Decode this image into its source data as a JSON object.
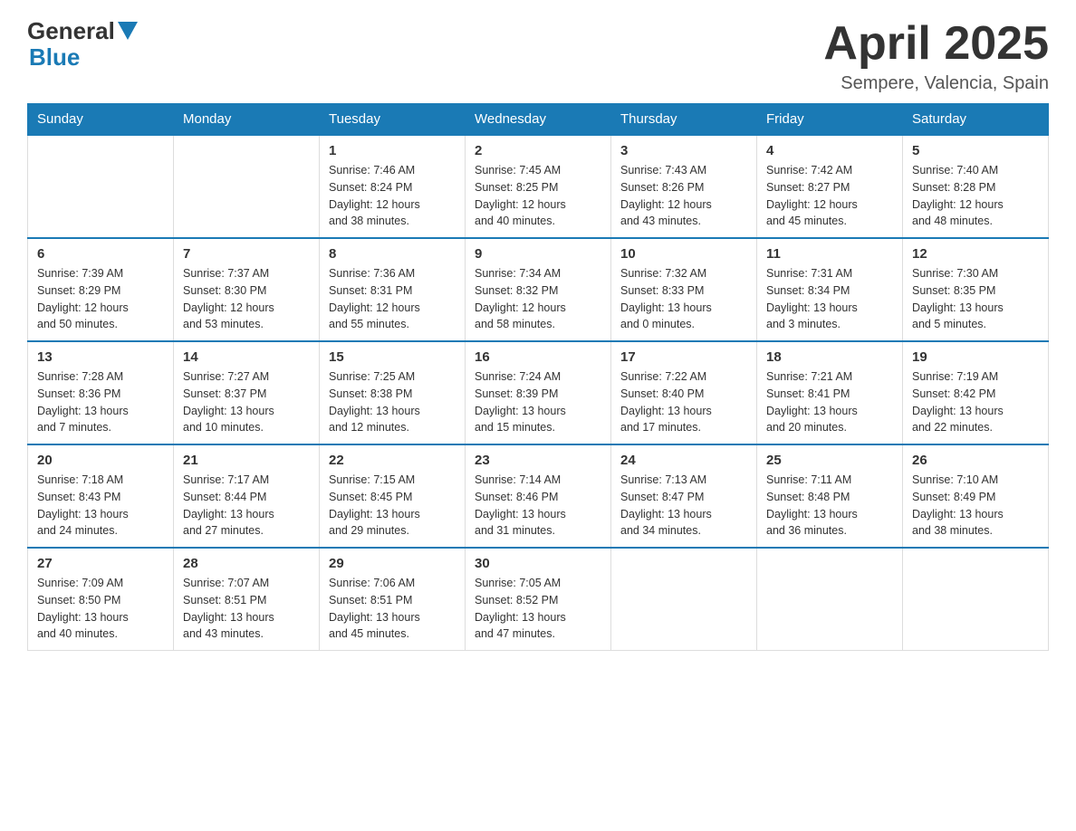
{
  "header": {
    "logo_general": "General",
    "logo_blue": "Blue",
    "month_title": "April 2025",
    "location": "Sempere, Valencia, Spain"
  },
  "days_of_week": [
    "Sunday",
    "Monday",
    "Tuesday",
    "Wednesday",
    "Thursday",
    "Friday",
    "Saturday"
  ],
  "weeks": [
    [
      {
        "day": "",
        "info": ""
      },
      {
        "day": "",
        "info": ""
      },
      {
        "day": "1",
        "info": "Sunrise: 7:46 AM\nSunset: 8:24 PM\nDaylight: 12 hours\nand 38 minutes."
      },
      {
        "day": "2",
        "info": "Sunrise: 7:45 AM\nSunset: 8:25 PM\nDaylight: 12 hours\nand 40 minutes."
      },
      {
        "day": "3",
        "info": "Sunrise: 7:43 AM\nSunset: 8:26 PM\nDaylight: 12 hours\nand 43 minutes."
      },
      {
        "day": "4",
        "info": "Sunrise: 7:42 AM\nSunset: 8:27 PM\nDaylight: 12 hours\nand 45 minutes."
      },
      {
        "day": "5",
        "info": "Sunrise: 7:40 AM\nSunset: 8:28 PM\nDaylight: 12 hours\nand 48 minutes."
      }
    ],
    [
      {
        "day": "6",
        "info": "Sunrise: 7:39 AM\nSunset: 8:29 PM\nDaylight: 12 hours\nand 50 minutes."
      },
      {
        "day": "7",
        "info": "Sunrise: 7:37 AM\nSunset: 8:30 PM\nDaylight: 12 hours\nand 53 minutes."
      },
      {
        "day": "8",
        "info": "Sunrise: 7:36 AM\nSunset: 8:31 PM\nDaylight: 12 hours\nand 55 minutes."
      },
      {
        "day": "9",
        "info": "Sunrise: 7:34 AM\nSunset: 8:32 PM\nDaylight: 12 hours\nand 58 minutes."
      },
      {
        "day": "10",
        "info": "Sunrise: 7:32 AM\nSunset: 8:33 PM\nDaylight: 13 hours\nand 0 minutes."
      },
      {
        "day": "11",
        "info": "Sunrise: 7:31 AM\nSunset: 8:34 PM\nDaylight: 13 hours\nand 3 minutes."
      },
      {
        "day": "12",
        "info": "Sunrise: 7:30 AM\nSunset: 8:35 PM\nDaylight: 13 hours\nand 5 minutes."
      }
    ],
    [
      {
        "day": "13",
        "info": "Sunrise: 7:28 AM\nSunset: 8:36 PM\nDaylight: 13 hours\nand 7 minutes."
      },
      {
        "day": "14",
        "info": "Sunrise: 7:27 AM\nSunset: 8:37 PM\nDaylight: 13 hours\nand 10 minutes."
      },
      {
        "day": "15",
        "info": "Sunrise: 7:25 AM\nSunset: 8:38 PM\nDaylight: 13 hours\nand 12 minutes."
      },
      {
        "day": "16",
        "info": "Sunrise: 7:24 AM\nSunset: 8:39 PM\nDaylight: 13 hours\nand 15 minutes."
      },
      {
        "day": "17",
        "info": "Sunrise: 7:22 AM\nSunset: 8:40 PM\nDaylight: 13 hours\nand 17 minutes."
      },
      {
        "day": "18",
        "info": "Sunrise: 7:21 AM\nSunset: 8:41 PM\nDaylight: 13 hours\nand 20 minutes."
      },
      {
        "day": "19",
        "info": "Sunrise: 7:19 AM\nSunset: 8:42 PM\nDaylight: 13 hours\nand 22 minutes."
      }
    ],
    [
      {
        "day": "20",
        "info": "Sunrise: 7:18 AM\nSunset: 8:43 PM\nDaylight: 13 hours\nand 24 minutes."
      },
      {
        "day": "21",
        "info": "Sunrise: 7:17 AM\nSunset: 8:44 PM\nDaylight: 13 hours\nand 27 minutes."
      },
      {
        "day": "22",
        "info": "Sunrise: 7:15 AM\nSunset: 8:45 PM\nDaylight: 13 hours\nand 29 minutes."
      },
      {
        "day": "23",
        "info": "Sunrise: 7:14 AM\nSunset: 8:46 PM\nDaylight: 13 hours\nand 31 minutes."
      },
      {
        "day": "24",
        "info": "Sunrise: 7:13 AM\nSunset: 8:47 PM\nDaylight: 13 hours\nand 34 minutes."
      },
      {
        "day": "25",
        "info": "Sunrise: 7:11 AM\nSunset: 8:48 PM\nDaylight: 13 hours\nand 36 minutes."
      },
      {
        "day": "26",
        "info": "Sunrise: 7:10 AM\nSunset: 8:49 PM\nDaylight: 13 hours\nand 38 minutes."
      }
    ],
    [
      {
        "day": "27",
        "info": "Sunrise: 7:09 AM\nSunset: 8:50 PM\nDaylight: 13 hours\nand 40 minutes."
      },
      {
        "day": "28",
        "info": "Sunrise: 7:07 AM\nSunset: 8:51 PM\nDaylight: 13 hours\nand 43 minutes."
      },
      {
        "day": "29",
        "info": "Sunrise: 7:06 AM\nSunset: 8:51 PM\nDaylight: 13 hours\nand 45 minutes."
      },
      {
        "day": "30",
        "info": "Sunrise: 7:05 AM\nSunset: 8:52 PM\nDaylight: 13 hours\nand 47 minutes."
      },
      {
        "day": "",
        "info": ""
      },
      {
        "day": "",
        "info": ""
      },
      {
        "day": "",
        "info": ""
      }
    ]
  ]
}
